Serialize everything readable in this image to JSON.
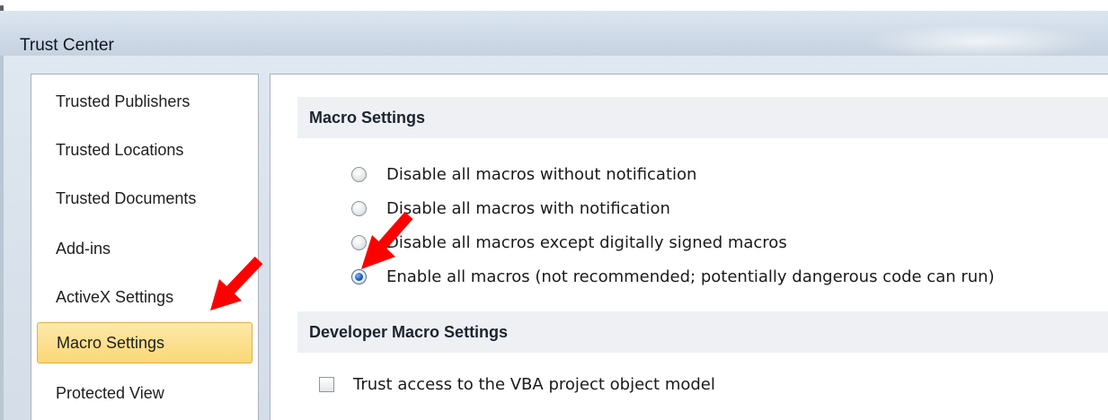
{
  "window": {
    "title": "Trust Center"
  },
  "nav": {
    "items": [
      {
        "label": "Trusted Publishers",
        "selected": false
      },
      {
        "label": "Trusted Locations",
        "selected": false
      },
      {
        "label": "Trusted Documents",
        "selected": false
      },
      {
        "label": "Add-ins",
        "selected": false
      },
      {
        "label": "ActiveX Settings",
        "selected": false
      },
      {
        "label": "Macro Settings",
        "selected": true
      },
      {
        "label": "Protected View",
        "selected": false
      }
    ]
  },
  "content": {
    "macro_settings": {
      "title": "Macro Settings",
      "options": [
        {
          "label": "Disable all macros without notification",
          "checked": false
        },
        {
          "label": "Disable all macros with notification",
          "checked": false
        },
        {
          "label": "Disable all macros except digitally signed macros",
          "checked": false
        },
        {
          "label": "Enable all macros (not recommended; potentially dangerous code can run)",
          "checked": true
        }
      ]
    },
    "developer_macro_settings": {
      "title": "Developer Macro Settings",
      "trust_vba": {
        "label": "Trust access to the VBA project object model",
        "checked": false
      }
    }
  },
  "colors": {
    "annotation_arrow": "#ff0000",
    "selected_nav_bg": "#fbd776",
    "selected_nav_border": "#e3ae49",
    "section_header_bg": "#eef0f3"
  }
}
